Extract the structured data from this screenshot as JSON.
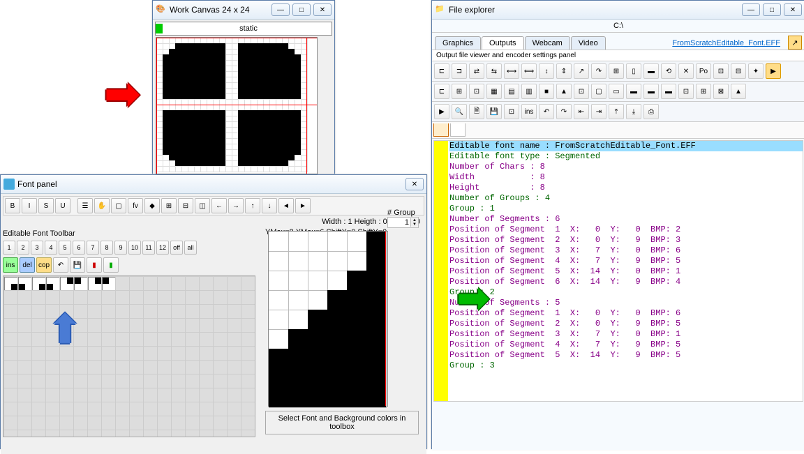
{
  "work_canvas": {
    "title": "Work Canvas 24 x 24",
    "static_label": "static"
  },
  "font_panel": {
    "title": "Font panel",
    "width_height_line": "Width : 1  Heigth : 0",
    "xy_line": "X:0 Y:0",
    "ymax_line": "YMax=8  XMax=6  ShiftX=0  ShiftY=0",
    "toolbar_label": "Editable Font Toolbar",
    "group_label": "# Group",
    "group_value": "1",
    "numbers": [
      "1",
      "2",
      "3",
      "4",
      "5",
      "6",
      "7",
      "8",
      "9",
      "10",
      "11",
      "12"
    ],
    "off_label": "off",
    "all_label": "all",
    "ins_label": "ins",
    "del_label": "del",
    "cop_label": "cop",
    "footer": "Select Font and Background colors in toolbox",
    "format_btns": [
      "B",
      "I",
      "S",
      "U"
    ],
    "misc_btns": [
      "☰",
      "✋",
      "▢",
      "fv",
      "◆",
      "⊞",
      "⊟",
      "◫",
      "←",
      "→",
      "↑",
      "↓",
      "◄",
      "►"
    ]
  },
  "file_explorer": {
    "title": "File explorer",
    "path": "C:\\",
    "tabs": [
      "Graphics",
      "Outputs",
      "Webcam",
      "Video"
    ],
    "active_tab": 1,
    "link": "FromScratchEditable_Font.EFF",
    "panel_label": "Output file viewer and encoder settings panel",
    "ins_label": "ins",
    "toolbar_icons_1": [
      "⊏",
      "⊐",
      "⇄",
      "⇆",
      "⟷",
      "⟺",
      "↕",
      "⇕",
      "↗",
      "↷",
      "⊞",
      "▯",
      "▬",
      "⟲",
      "✕",
      "Po",
      "⊡",
      "⊟",
      "✦",
      "▶"
    ],
    "toolbar_icons_2": [
      "⊏",
      "⊞",
      "⊡",
      "▦",
      "▤",
      "▥",
      "■",
      "▲",
      "⊡",
      "▢",
      "▭",
      "▬",
      "▬",
      "▬",
      "⊡",
      "⊞",
      "⊠",
      "▲"
    ],
    "toolbar_icons_3": [
      "▶",
      "🔍",
      "🗎",
      "💾",
      "⊡",
      "ins",
      "↶",
      "↷",
      "⇤",
      "⇥",
      "⤒",
      "⤓",
      "⎙"
    ],
    "output_lines": [
      {
        "cls": "hl",
        "text": "Editable font name : FromScratchEditable_Font.EFF"
      },
      {
        "cls": "grn",
        "text": "Editable font type : Segmented"
      },
      {
        "cls": "pur",
        "text": "Number of Chars : 8"
      },
      {
        "cls": "pur",
        "text": "Width           : 8"
      },
      {
        "cls": "pur",
        "text": "Height          : 8"
      },
      {
        "cls": "grn",
        "text": "Number of Groups : 4"
      },
      {
        "cls": "grn",
        "text": "Group : 1"
      },
      {
        "cls": "pur",
        "text": "Number of Segments : 6"
      },
      {
        "cls": "pur",
        "text": "Position of Segment  1  X:   0  Y:   0  BMP: 2"
      },
      {
        "cls": "pur",
        "text": "Position of Segment  2  X:   0  Y:   9  BMP: 3"
      },
      {
        "cls": "pur",
        "text": "Position of Segment  3  X:   7  Y:   0  BMP: 6"
      },
      {
        "cls": "pur",
        "text": "Position of Segment  4  X:   7  Y:   9  BMP: 5"
      },
      {
        "cls": "pur",
        "text": "Position of Segment  5  X:  14  Y:   0  BMP: 1"
      },
      {
        "cls": "pur",
        "text": "Position of Segment  6  X:  14  Y:   9  BMP: 4"
      },
      {
        "cls": "grn",
        "text": "Group : 2"
      },
      {
        "cls": "pur",
        "text": "Number of Segments : 5"
      },
      {
        "cls": "pur",
        "text": "Position of Segment  1  X:   0  Y:   0  BMP: 6"
      },
      {
        "cls": "pur",
        "text": "Position of Segment  2  X:   0  Y:   9  BMP: 5"
      },
      {
        "cls": "pur",
        "text": "Position of Segment  3  X:   7  Y:   0  BMP: 1"
      },
      {
        "cls": "pur",
        "text": "Position of Segment  4  X:   7  Y:   9  BMP: 5"
      },
      {
        "cls": "pur",
        "text": "Position of Segment  5  X:  14  Y:   9  BMP: 5"
      },
      {
        "cls": "grn",
        "text": "Group : 3"
      }
    ]
  }
}
